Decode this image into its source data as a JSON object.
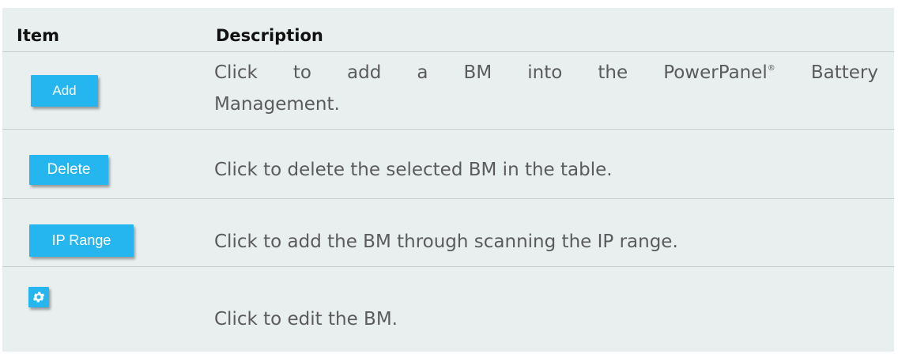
{
  "table": {
    "headers": {
      "item": "Item",
      "description": "Description"
    },
    "rows": [
      {
        "button_label": "Add",
        "description_line1": "Click to add a BM into the PowerPanel",
        "description_reg": "®",
        "description_line1_end": " Battery",
        "description_line2": "Management."
      },
      {
        "button_label": "Delete",
        "description": "Click to delete the selected BM in the table."
      },
      {
        "button_label": "IP Range",
        "description": "Click to add the BM through scanning the IP range."
      },
      {
        "icon": "gear-icon",
        "description": "Click to edit the BM."
      }
    ]
  },
  "colors": {
    "button_bg": "#25b6f0",
    "table_bg": "#e9eeee",
    "text": "#5b5b5b"
  }
}
